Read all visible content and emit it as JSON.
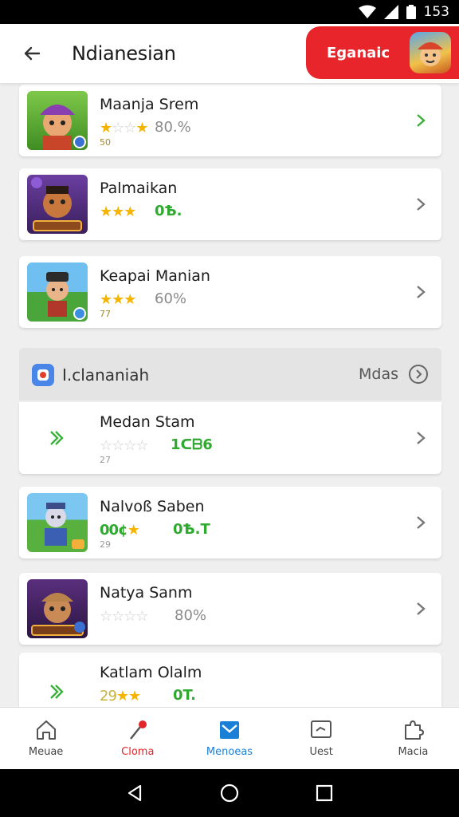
{
  "status_bar": {
    "time": "153"
  },
  "app_bar": {
    "title": "Ndianesian",
    "promo_label": "Eganaic"
  },
  "items": [
    {
      "title": "Maanja Srem",
      "stars_on": 1,
      "rating": "80.%",
      "rating_style": "gray",
      "sub": "50"
    },
    {
      "title": "Palmaikan",
      "stars_on": 3,
      "rating": "0Ѣ.",
      "rating_style": "green",
      "sub": ""
    },
    {
      "title": "Keapai Manian",
      "stars_on": 3,
      "rating": "60%",
      "rating_style": "gray",
      "sub": "77"
    }
  ],
  "section": {
    "title": "I.clananiah",
    "more_label": "Mdas"
  },
  "section_items": [
    {
      "title": "Medan Stam",
      "stars_on": 0,
      "rating": "1ᑕᗷ6",
      "rating_style": "green",
      "sub": "27"
    },
    {
      "title": "Nalvoß Saben",
      "stars_on": 1,
      "stars_prefix": "00¢",
      "rating": "0Ѣ.T",
      "rating_style": "green",
      "sub": "29"
    },
    {
      "title": "Natya Sanm",
      "stars_on": 0,
      "rating": "80%",
      "rating_style": "gray",
      "sub": ""
    },
    {
      "title": "Katlam Olalm",
      "stars_on": 2,
      "stars_prefix": "29",
      "rating": "0T.",
      "rating_style": "green",
      "sub": ""
    }
  ],
  "bottom_nav": [
    {
      "label": "Meuae"
    },
    {
      "label": "Cloma"
    },
    {
      "label": "Menoeas"
    },
    {
      "label": "Uest"
    },
    {
      "label": "Macia"
    }
  ],
  "colors": {
    "accent_red": "#e8252b",
    "accent_blue": "#1a7fd6",
    "star_gold": "#f5b400",
    "rating_green": "#2fa92f"
  }
}
